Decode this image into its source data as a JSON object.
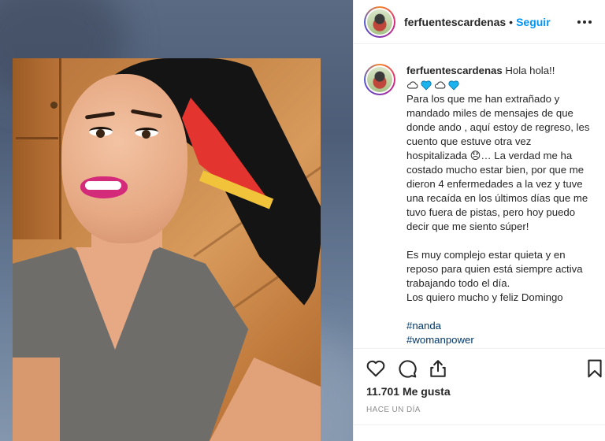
{
  "post": {
    "username": "ferfuentescardenas",
    "follow_label": "Seguir",
    "separator": "•"
  },
  "caption": {
    "username": "ferfuentescardenas",
    "lines": [
      "Hola hola!!",
      "Para los que me han extrañado y mandado miles de mensajes de que donde ando , aquí estoy de regreso, les cuento que estuve otra vez hospitalizada 😞… La verdad me ha costado mucho estar bien, por que me dieron 4 enfermedades a la vez y tuve una recaída en los últimos días que me tuvo fuera de pistas, pero hoy puedo decir que me siento súper!",
      "",
      "Es muy complejo estar quieta y en reposo para quien está siempre activa trabajando todo el día.",
      "Los quiero mucho y feliz Domingo",
      ""
    ],
    "hashtags": [
      "#nanda",
      "#womanpower"
    ]
  },
  "actions": {
    "likes_text": "11.701 Me gusta",
    "time_text": "HACE UN DÍA"
  },
  "colors": {
    "link_blue": "#0095f6",
    "hashtag": "#00376b",
    "heart_emoji": "#1ab3f0"
  },
  "icons": [
    "more-options-icon",
    "like-heart-icon",
    "comment-icon",
    "share-icon",
    "save-bookmark-icon",
    "cloud-emoji",
    "blue-heart-emoji"
  ]
}
